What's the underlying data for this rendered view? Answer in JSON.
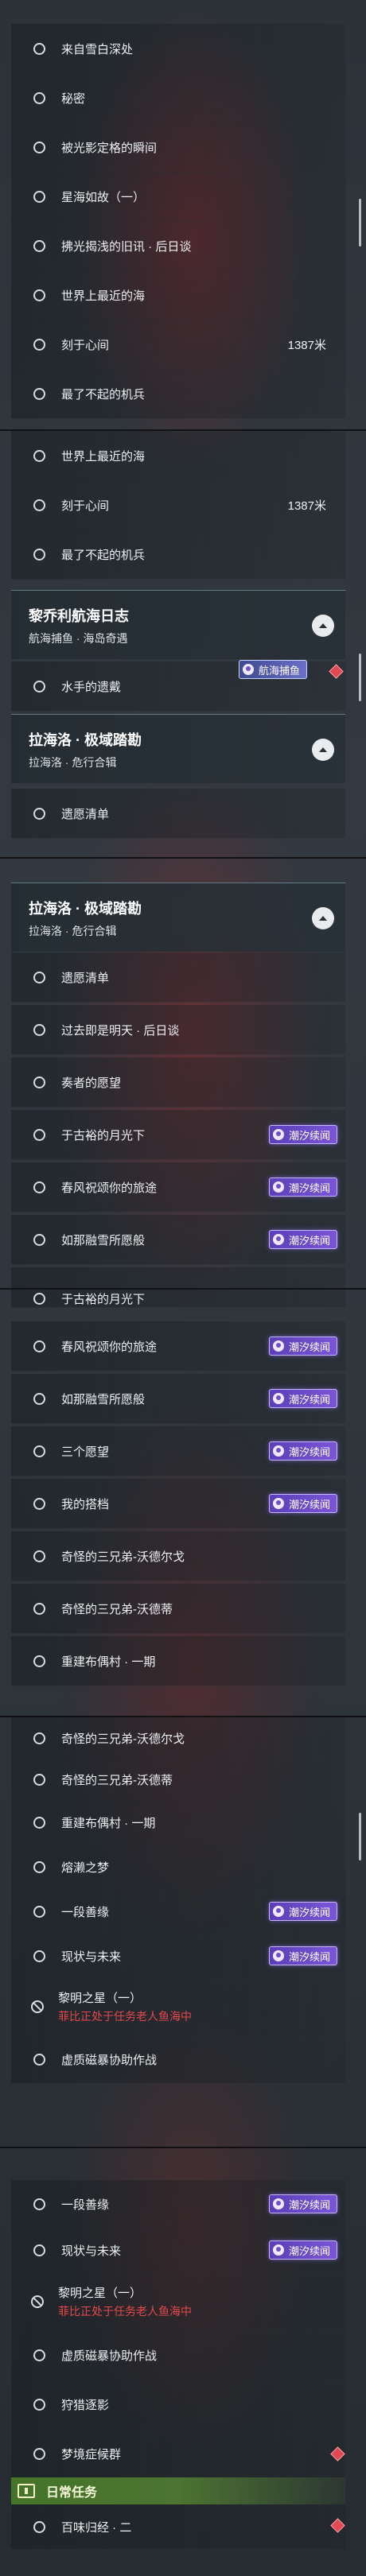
{
  "tag_labels": {
    "chaoxi": "潮汐续闻",
    "hanghai": "航海捕鱼"
  },
  "warning": "菲比正处于任务老人鱼海中",
  "colors": {
    "tag_purple": "#6b4fd0",
    "warning_red": "#e5484d",
    "daily_green": "#5a8c32"
  },
  "s1": {
    "items": [
      {
        "label": "来自雪白深处"
      },
      {
        "label": "秘密"
      },
      {
        "label": "被光影定格的瞬间"
      },
      {
        "label": "星海如故（一）"
      },
      {
        "label": "拂光揭浅的旧讯 · 后日谈"
      },
      {
        "label": "世界上最近的海"
      },
      {
        "label": "刻于心间",
        "value": "1387米"
      },
      {
        "label": "最了不起的机兵"
      }
    ]
  },
  "s2": {
    "items": [
      {
        "label": "世界上最近的海"
      },
      {
        "label": "刻于心间",
        "value": "1387米"
      },
      {
        "label": "最了不起的机兵"
      }
    ],
    "header1": {
      "title": "黎乔利航海日志",
      "subtitle": "航海捕鱼 · 海岛奇遇"
    },
    "item_after_h1": {
      "label": "水手的遗戴"
    },
    "header2": {
      "title": "拉海洛 · 极域踏勘",
      "subtitle": "拉海洛 · 危行合辑"
    },
    "item_after_h2": {
      "label": "遗愿清单"
    }
  },
  "s3": {
    "header": {
      "title": "拉海洛 · 极域踏勘",
      "subtitle": "拉海洛 · 危行合辑"
    },
    "items": [
      {
        "label": "遗愿清单"
      },
      {
        "label": "过去即是明天 · 后日谈"
      },
      {
        "label": "奏者的愿望"
      },
      {
        "label": "于古裕的月光下"
      },
      {
        "label": "春风祝颂你的旅途"
      },
      {
        "label": "如那融雪所愿般"
      }
    ]
  },
  "s4": {
    "partial": "于古裕的月光下",
    "items": [
      {
        "label": "春风祝颂你的旅途"
      },
      {
        "label": "如那融雪所愿般"
      },
      {
        "label": "三个愿望"
      },
      {
        "label": "我的搭档"
      },
      {
        "label": "奇怪的三兄弟-沃德尔戈"
      },
      {
        "label": "奇怪的三兄弟-沃德蒂"
      },
      {
        "label": "重建布偶村 · 一期"
      }
    ]
  },
  "s5": {
    "items": [
      {
        "label": "奇怪的三兄弟-沃德尔戈"
      },
      {
        "label": "奇怪的三兄弟-沃德蒂"
      },
      {
        "label": "重建布偶村 · 一期"
      },
      {
        "label": "熔濑之梦"
      },
      {
        "label": "一段善缘"
      },
      {
        "label": "现状与未来"
      },
      {
        "label": "黎明之星（一）"
      },
      {
        "label": "虚质磁暴协助作战"
      }
    ]
  },
  "s6": {
    "items": [
      {
        "label": "一段善缘"
      },
      {
        "label": "现状与未来"
      },
      {
        "label": "黎明之星（一）"
      },
      {
        "label": "虚质磁暴协助作战"
      },
      {
        "label": "狩猎逐影"
      },
      {
        "label": "梦境症候群"
      }
    ],
    "daily_title": "日常任务",
    "daily_item": {
      "label": "百味归经 · 二"
    }
  }
}
